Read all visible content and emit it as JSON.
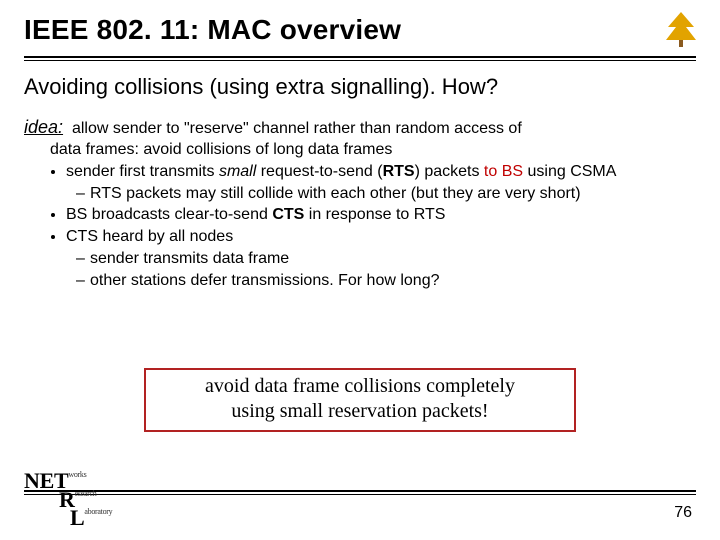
{
  "title": "IEEE 802. 11: MAC overview",
  "subtitle": "Avoiding collisions (using extra signalling). How?",
  "idea": {
    "label": "idea:",
    "text": "allow sender to \"reserve\" channel rather than random access of",
    "cont": "data frames: avoid  collisions of long  data frames"
  },
  "b1": {
    "pre": "sender first transmits ",
    "ital": "small",
    "mid": " request-to-send (",
    "bold": "RTS",
    "post1": ") packets ",
    "red": "to BS",
    "post2": " using CSMA",
    "sub1": "RTS packets may still collide with each other (but they are very short)"
  },
  "b2": {
    "pre": "BS broadcasts clear-to-send ",
    "bold": "CTS",
    "post": " in response to RTS"
  },
  "b3": {
    "text": "CTS heard by all nodes",
    "sub1": "sender transmits data frame",
    "sub2": "other stations defer transmissions. For how long?"
  },
  "callout": {
    "line1": "avoid data frame collisions completely",
    "line2": "using small reservation packets!"
  },
  "logo": {
    "l1a": "NET",
    "l1b": "works",
    "l2a": "R",
    "l2b": "esearch",
    "l3a": "L",
    "l3b": "aboratory"
  },
  "page": "76"
}
